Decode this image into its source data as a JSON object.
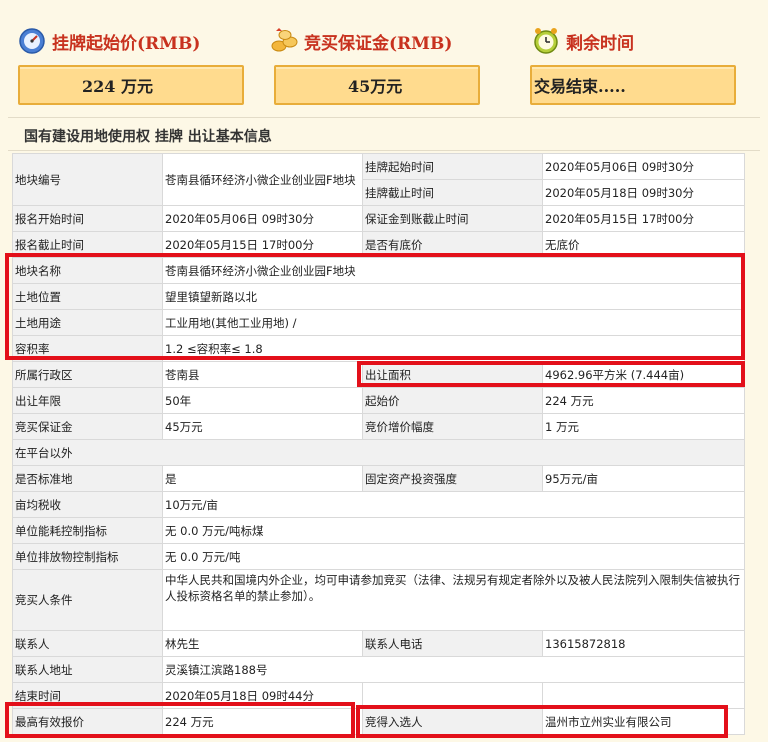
{
  "summary": {
    "start_price_label": "挂牌起始价(RMB)",
    "start_price_value": "224 万元",
    "deposit_label": "竞买保证金(RMB)",
    "deposit_value": "45万元",
    "remaining_label": "剩余时间",
    "remaining_value": "交易结束....."
  },
  "section_title": "国有建设用地使用权 挂牌 出让基本信息",
  "fields": {
    "parcel_no_label": "地块编号",
    "parcel_no": "苍南县循环经济小微企业创业园F地块",
    "listing_start_label": "挂牌起始时间",
    "listing_start": "2020年05月06日 09时30分",
    "listing_end_label": "挂牌截止时间",
    "listing_end": "2020年05月18日 09时30分",
    "reg_start_label": "报名开始时间",
    "reg_start": "2020年05月06日 09时30分",
    "deposit_deadline_label": "保证金到账截止时间",
    "deposit_deadline": "2020年05月15日 17时00分",
    "reg_end_label": "报名截止时间",
    "reg_end": "2020年05月15日 17时00分",
    "reserve_label": "是否有底价",
    "reserve": "无底价",
    "parcel_name_label": "地块名称",
    "parcel_name": "苍南县循环经济小微企业创业园F地块",
    "location_label": "土地位置",
    "location": "望里镇望新路以北",
    "use_label": "土地用途",
    "use": "工业用地(其他工业用地) /",
    "far_label": "容积率",
    "far": "1.2 ≤容积率≤ 1.8",
    "district_label": "所属行政区",
    "district": "苍南县",
    "area_label": "出让面积",
    "area": "4962.96平方米 (7.444亩)",
    "term_label": "出让年限",
    "term": "50年",
    "start_price_label": "起始价",
    "start_price": "224 万元",
    "bid_deposit_label": "竞买保证金",
    "bid_deposit": "45万元",
    "increment_label": "竞价增价幅度",
    "increment": "1 万元",
    "platform_note": "在平台以外",
    "standard_label": "是否标准地",
    "standard": "是",
    "investment_label": "固定资产投资强度",
    "investment": "95万元/亩",
    "tax_label": "亩均税收",
    "tax": "10万元/亩",
    "energy_label": "单位能耗控制指标",
    "energy": "无 0.0 万元/吨标煤",
    "emission_label": "单位排放物控制指标",
    "emission": "无 0.0 万元/吨",
    "bidder_label": "竞买人条件",
    "bidder": "中华人民共和国境内外企业，均可申请参加竞买（法律、法规另有规定者除外以及被人民法院列入限制失信被执行人投标资格名单的禁止参加）。",
    "contact_label": "联系人",
    "contact": "林先生",
    "phone_label": "联系人电话",
    "phone": "13615872818",
    "address_label": "联系人地址",
    "address": "灵溪镇江滨路188号",
    "end_time_label": "结束时间",
    "end_time": "2020年05月18日 09时44分",
    "highest_bid_label": "最高有效报价",
    "highest_bid": "224 万元",
    "winner_label": "竞得入选人",
    "winner": "温州市立州实业有限公司"
  },
  "colors": {
    "accent_red": "#c8321f",
    "highlight_box": "#e3101a",
    "stat_box_fill": "#ffdb8e"
  }
}
